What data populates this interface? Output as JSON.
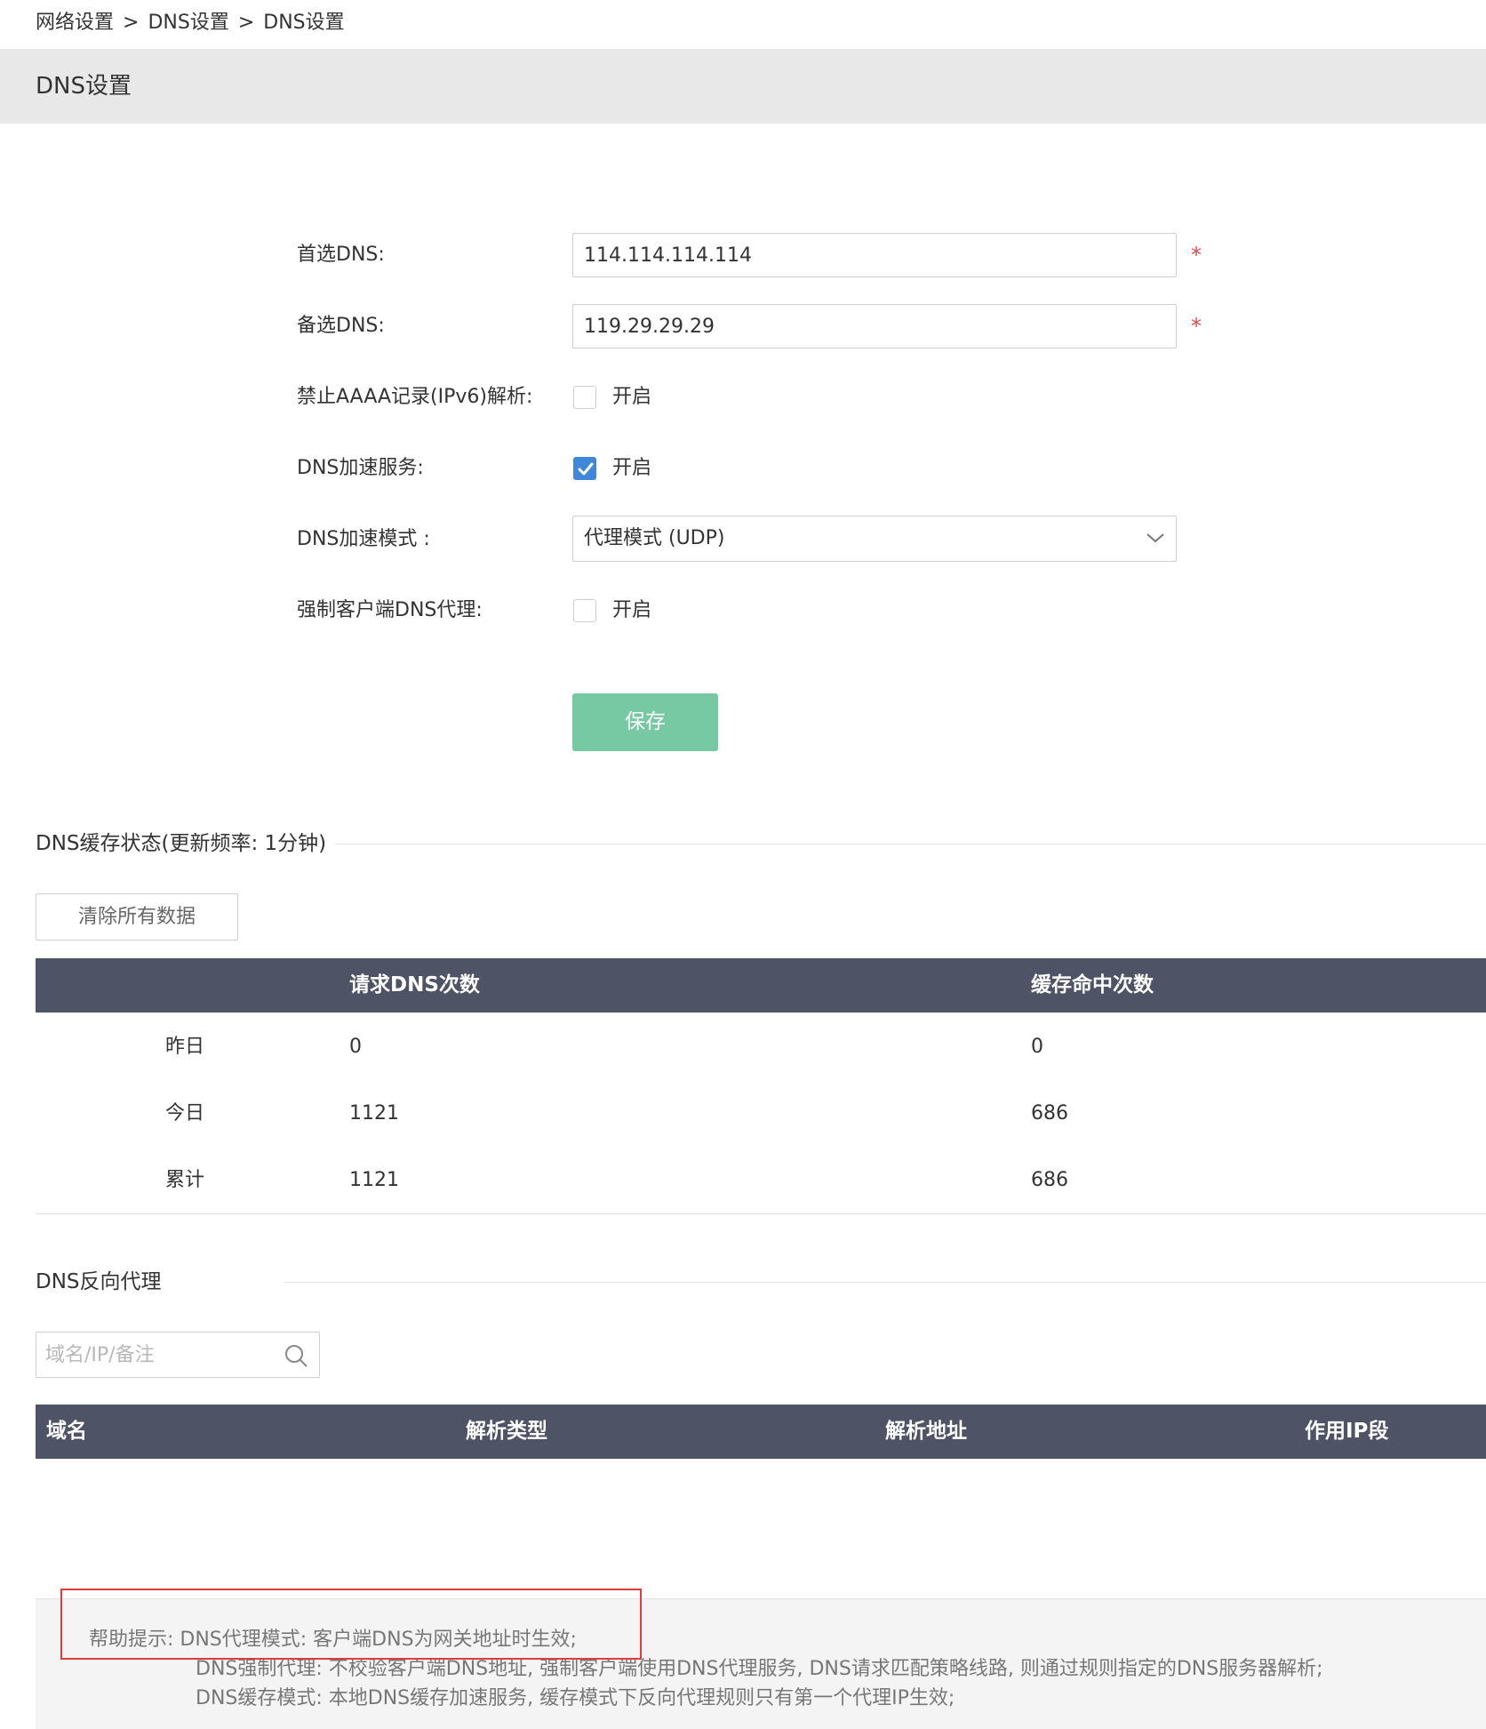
{
  "breadcrumb": {
    "items": [
      "网络设置",
      "DNS设置",
      "DNS设置"
    ],
    "separator": ">"
  },
  "page_title": "DNS设置",
  "form": {
    "primary_dns": {
      "label": "首选DNS:",
      "value": "114.114.114.114",
      "required_mark": "*"
    },
    "secondary_dns": {
      "label": "备选DNS:",
      "value": "119.29.29.29",
      "required_mark": "*"
    },
    "block_aaaa": {
      "label": "禁止AAAA记录(IPv6)解析:",
      "checked": false,
      "option_label": "开启"
    },
    "dns_acceleration": {
      "label": "DNS加速服务:",
      "checked": true,
      "option_label": "开启"
    },
    "acceleration_mode": {
      "label": "DNS加速模式 :",
      "selected": "代理模式 (UDP)"
    },
    "force_client_proxy": {
      "label": "强制客户端DNS代理:",
      "checked": false,
      "option_label": "开启"
    },
    "save_label": "保存"
  },
  "cache_status": {
    "title": "DNS缓存状态(更新频率: 1分钟)",
    "clear_label": "清除所有数据",
    "columns": [
      "",
      "请求DNS次数",
      "缓存命中次数"
    ],
    "rows": [
      {
        "label": "昨日",
        "requests": "0",
        "hits": "0"
      },
      {
        "label": "今日",
        "requests": "1121",
        "hits": "686"
      },
      {
        "label": "累计",
        "requests": "1121",
        "hits": "686"
      }
    ]
  },
  "reverse_proxy": {
    "title": "DNS反向代理",
    "search_placeholder": "域名/IP/备注",
    "columns": [
      "域名",
      "解析类型",
      "解析地址",
      "作用IP段"
    ]
  },
  "help": {
    "lines": [
      "帮助提示: DNS代理模式: 客户端DNS为网关地址时生效;",
      "DNS强制代理: 不校验客户端DNS地址, 强制客户端使用DNS代理服务, DNS请求匹配策略线路, 则通过规则指定的DNS服务器解析;",
      "DNS缓存模式: 本地DNS缓存加速服务, 缓存模式下反向代理规则只有第一个代理IP生效;"
    ]
  },
  "colors": {
    "table_header": "#4e5366",
    "save_button": "#76c9a3",
    "checkbox_checked": "#3f88d9",
    "required": "#e94848",
    "help_highlight": "#e03c3c"
  }
}
